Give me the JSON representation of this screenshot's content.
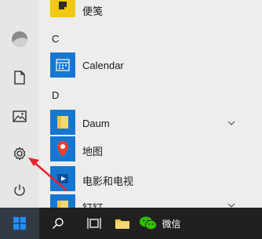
{
  "app_list": {
    "top_partial": {
      "label": "便笺",
      "icon": "sticky-notes-icon"
    },
    "section_c": "C",
    "calendar": {
      "label": "Calendar",
      "icon": "calendar-icon"
    },
    "section_d": "D",
    "daum": {
      "label": "Daum",
      "icon": "folder-icon"
    },
    "maps": {
      "label": "地图",
      "icon": "maps-pin-icon"
    },
    "movies": {
      "label": "电影和电视",
      "icon": "movies-tv-icon"
    },
    "bottom_partial": {
      "label": "钉钉",
      "icon": "folder-icon"
    }
  },
  "rail": {
    "items": [
      "user-avatar",
      "documents-icon",
      "pictures-icon",
      "settings-icon",
      "power-icon"
    ]
  },
  "taskbar": {
    "wechat_label": "微信",
    "items": [
      "windows-logo-icon",
      "search-icon",
      "task-view-icon",
      "file-explorer-icon",
      "wechat-icon"
    ]
  },
  "colors": {
    "menu_bg": "#ededed",
    "taskbar_bg": "#202020",
    "accent_blue": "#1677d2",
    "annotation_red": "#e8232b"
  }
}
